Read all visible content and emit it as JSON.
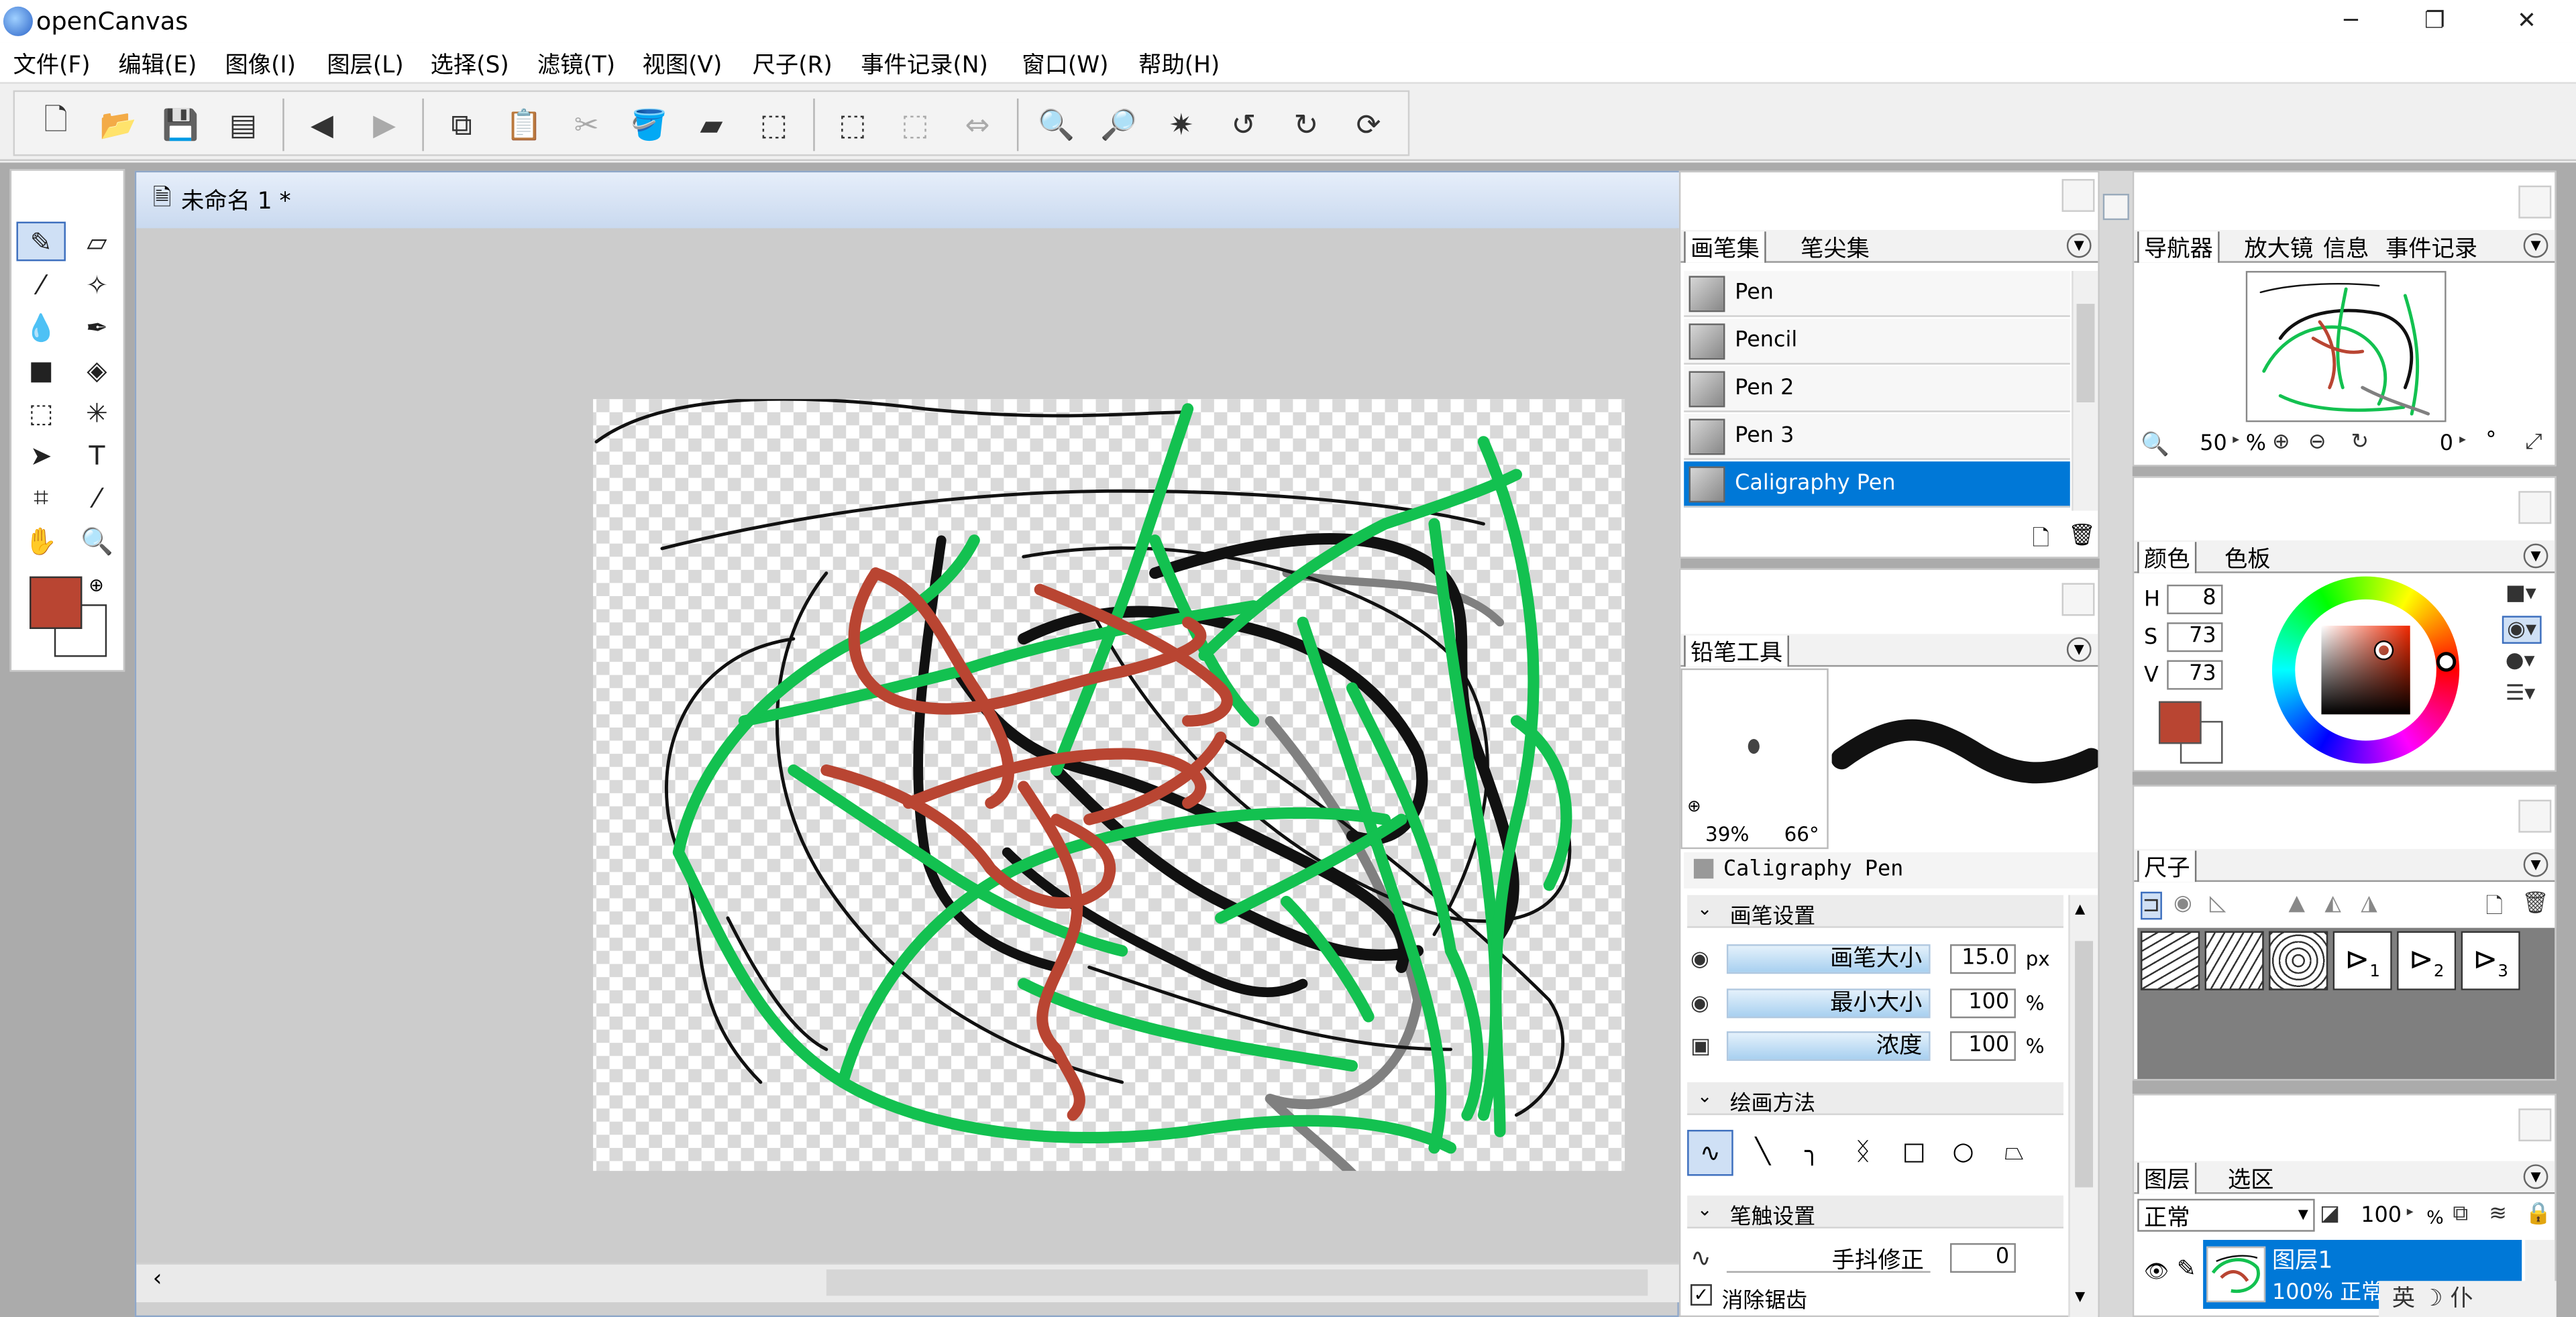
{
  "app": {
    "title": "openCanvas"
  },
  "window_controls": {
    "minimize": "─",
    "restore": "❐",
    "close": "✕"
  },
  "menu": [
    "文件(F)",
    "编辑(E)",
    "图像(I)",
    "图层(L)",
    "选择(S)",
    "滤镜(T)",
    "视图(V)",
    "尺子(R)",
    "事件记录(N)",
    "窗口(W)",
    "帮助(H)"
  ],
  "document": {
    "title": "未命名 1 *"
  },
  "toolbox": {
    "fg_color": "#b94532",
    "bg_color": "#ffffff"
  },
  "brush_panel": {
    "tabs": [
      "画笔集",
      "笔尖集"
    ],
    "items": [
      "Pen",
      "Pencil",
      "Pen 2",
      "Pen 3",
      "Caligraphy Pen"
    ],
    "selected": "Caligraphy Pen"
  },
  "pencil_panel": {
    "tab": "铅笔工具",
    "preview_pct": "39%",
    "preview_deg": "66°",
    "brush_name": "Caligraphy Pen",
    "brush_settings": {
      "label": "画笔设置",
      "size_label": "画笔大小",
      "size_value": "15.0",
      "size_unit": "px",
      "min_label": "最小大小",
      "min_value": "100",
      "min_unit": "%",
      "density_label": "浓度",
      "density_value": "100",
      "density_unit": "%"
    },
    "draw_method": {
      "label": "绘画方法"
    },
    "stroke_settings": {
      "label": "笔触设置",
      "stabilizer_label": "手抖修正",
      "stabilizer_value": "0"
    },
    "antialias_label": "消除锯齿"
  },
  "navigator": {
    "tabs": [
      "导航器",
      "放大镜",
      "信息",
      "事件记录"
    ],
    "zoom": "50",
    "zoom_unit": "%",
    "rotation": "0",
    "rotation_unit": "°"
  },
  "color_panel": {
    "tabs": [
      "颜色",
      "色板"
    ],
    "h_label": "H",
    "h": "8",
    "s_label": "S",
    "s": "73",
    "v_label": "V",
    "v": "73",
    "current": "#b94532"
  },
  "ruler_panel": {
    "tabs": [
      "尺子"
    ],
    "ruler_numbers": [
      "1",
      "2",
      "3"
    ]
  },
  "layer_panel": {
    "tabs": [
      "图层",
      "选区"
    ],
    "blend_mode": "正常",
    "opacity": "100",
    "opacity_unit": "%",
    "layer_name": "图层1",
    "layer_info": "100% 正常"
  },
  "ime": {
    "text": "英 ☽ 仆"
  }
}
